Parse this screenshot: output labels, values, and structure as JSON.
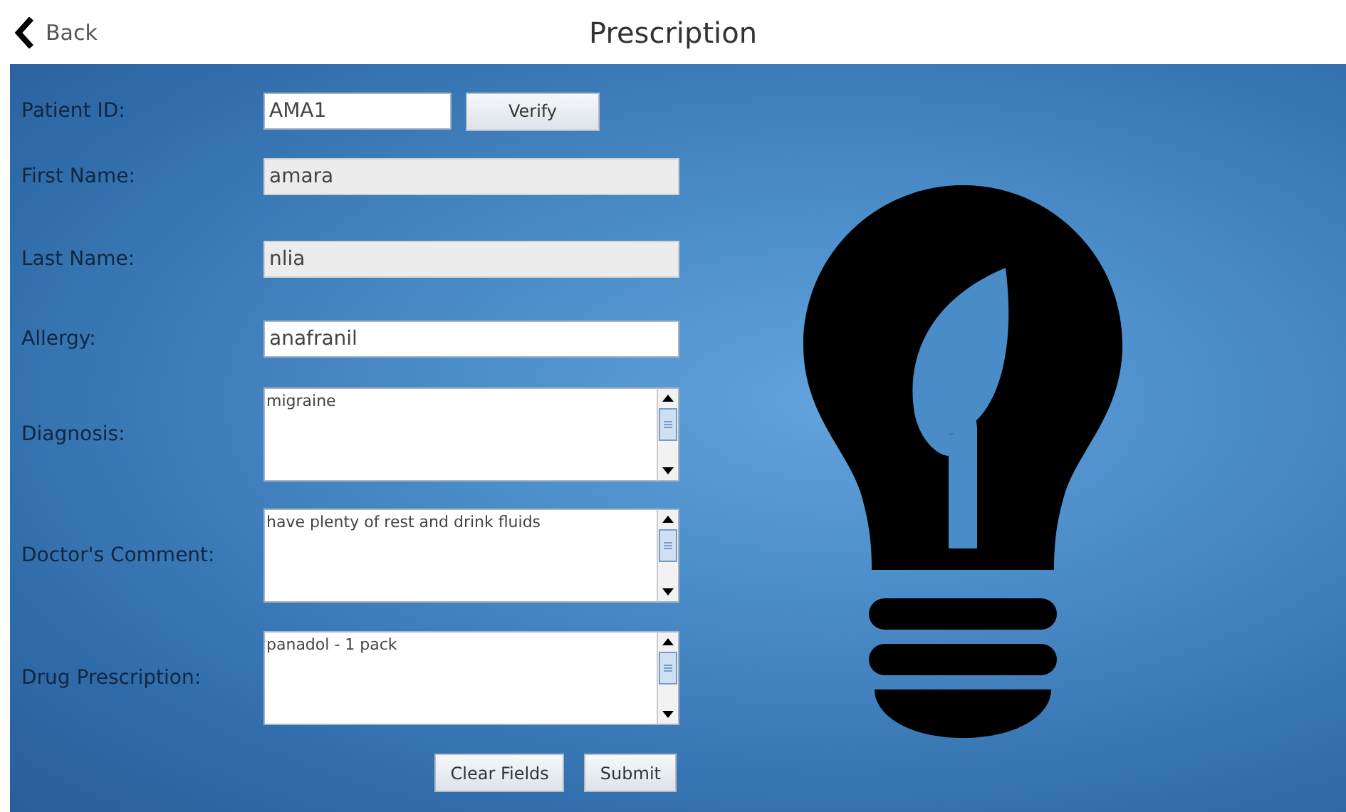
{
  "header": {
    "back": "Back",
    "title": "Prescription"
  },
  "fields": [
    {
      "kind": "text",
      "label": "Patient ID:",
      "value": "AMA1",
      "disabled": false,
      "button": "Verify"
    },
    {
      "kind": "text",
      "label": "First Name:",
      "value": "amara",
      "disabled": true
    },
    {
      "kind": "text",
      "label": "Last Name:",
      "value": "nlia",
      "disabled": true
    },
    {
      "kind": "text",
      "label": "Allergy:",
      "value": "anafranil",
      "disabled": false
    },
    {
      "kind": "multiline",
      "label": "Diagnosis:",
      "value": "migraine",
      "disabled": false
    },
    {
      "kind": "multiline",
      "label": "Doctor's Comment:",
      "value": "have plenty of rest and drink fluids",
      "disabled": false
    },
    {
      "kind": "multiline",
      "label": "Drug Prescription:",
      "value": "panadol - 1 pack",
      "disabled": false
    }
  ],
  "buttons": [
    "Clear Fields",
    "Submit"
  ]
}
